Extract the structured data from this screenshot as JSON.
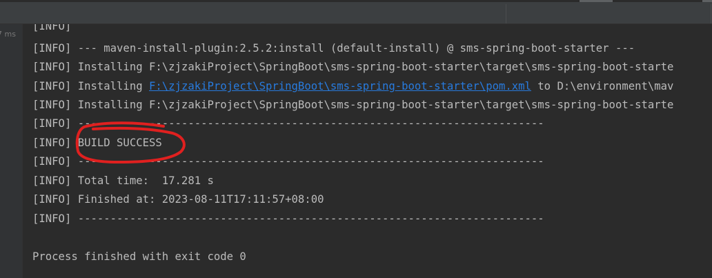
{
  "gutter": {
    "duration": "7 ms"
  },
  "console": {
    "line_0": "[INFO]",
    "line_1": "[INFO] --- maven-install-plugin:2.5.2:install (default-install) @ sms-spring-boot-starter ---",
    "line_2": "[INFO] Installing F:\\zjzakiProject\\SpringBoot\\sms-spring-boot-starter\\target\\sms-spring-boot-starte",
    "line_3": {
      "prefix": "[INFO] Installing ",
      "link": "F:\\zjzakiProject\\SpringBoot\\sms-spring-boot-starter\\pom.xml",
      "suffix": " to D:\\environment\\mav"
    },
    "line_4": "[INFO] Installing F:\\zjzakiProject\\SpringBoot\\sms-spring-boot-starter\\target\\sms-spring-boot-starte",
    "line_5": "[INFO] ------------------------------------------------------------------------",
    "line_6": "[INFO] BUILD SUCCESS",
    "line_7": "[INFO] ------------------------------------------------------------------------",
    "line_8": "[INFO] Total time:  17.281 s",
    "line_9": "[INFO] Finished at: 2023-08-11T17:11:57+08:00",
    "line_10": "[INFO] ------------------------------------------------------------------------",
    "line_11": "Process finished with exit code 0"
  },
  "colors": {
    "background": "#2b2b2b",
    "text": "#bbbbbb",
    "link": "#287bde",
    "annotation": "#e0201f"
  }
}
